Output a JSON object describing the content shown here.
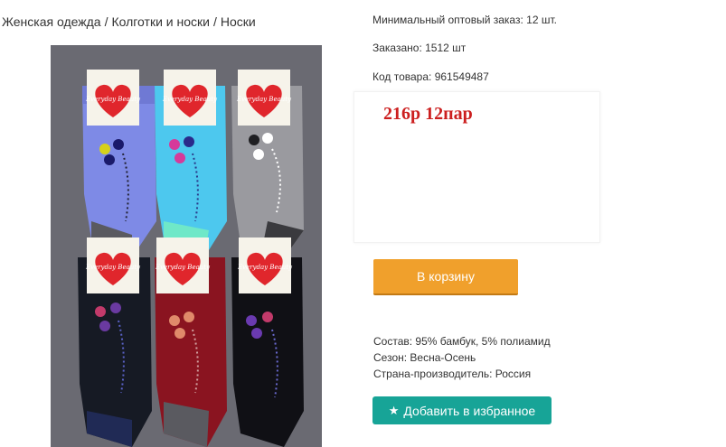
{
  "breadcrumb": {
    "items": [
      "Женская одежда",
      "Колготки и носки",
      "Носки"
    ],
    "separator": "/"
  },
  "product": {
    "min_order": "Минимальный оптовый заказ: 12 шт.",
    "ordered": "Заказано: 1512 шт",
    "code": "Код товара: 961549487",
    "price_note": "216р 12пар",
    "image_label": "Everyday Beauty"
  },
  "cart_button": {
    "label": "В корзину"
  },
  "properties": [
    "Состав: 95% бамбук, 5% полиамид",
    "Сезон: Весна-Осень",
    "Страна-производитель: Россия"
  ],
  "favorite_button": {
    "label": "Добавить в избранное",
    "icon": "star-icon"
  },
  "colors": {
    "cart_button": "#f0a02c",
    "favorite_button": "#17a497",
    "price_text": "#cc1f1f",
    "photo_background": "#6a6a72"
  }
}
